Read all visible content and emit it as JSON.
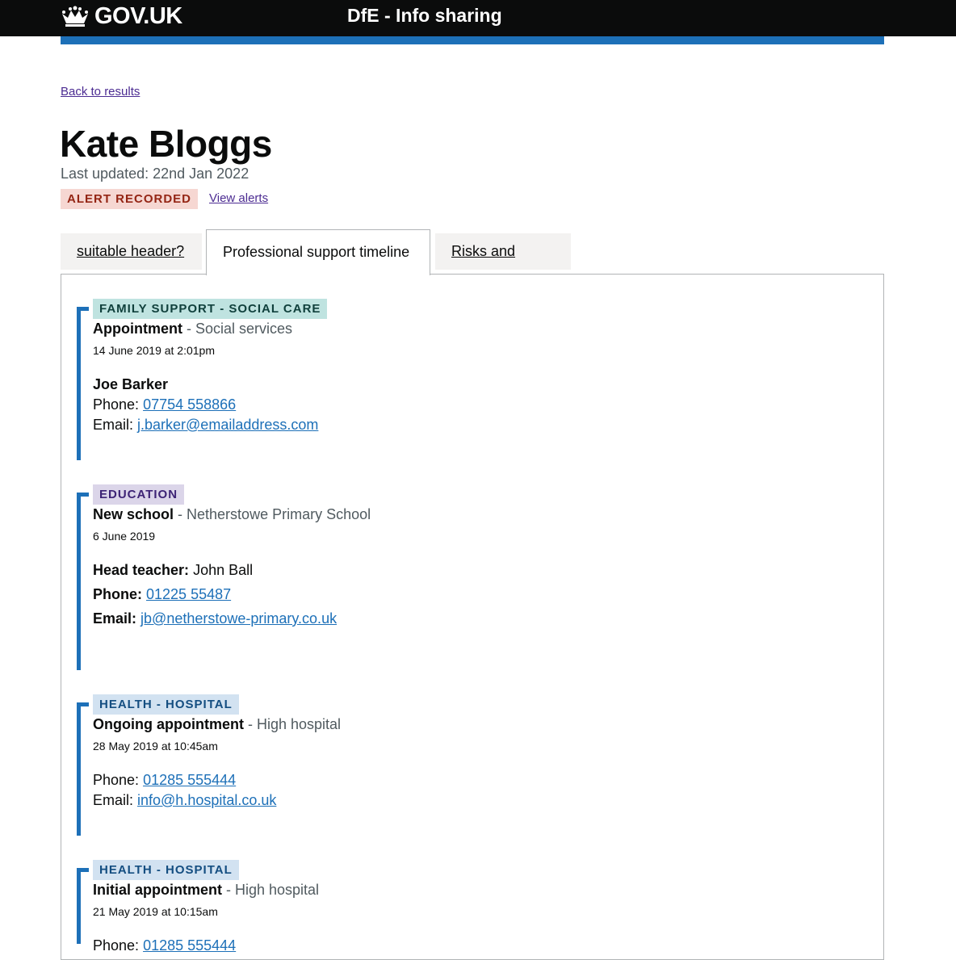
{
  "header": {
    "logo_text": "GOV.UK",
    "service_name": "DfE - Info sharing"
  },
  "page": {
    "back_link": "Back to results",
    "title": "Kate Bloggs",
    "last_updated": "Last updated: 22nd Jan 2022",
    "alert_tag": "ALERT RECORDED",
    "view_alerts": "View alerts"
  },
  "tabs": [
    {
      "label": "suitable header?",
      "active": false
    },
    {
      "label": "Professional support timeline",
      "active": true
    },
    {
      "label": "Risks and alerts",
      "active": false
    }
  ],
  "timeline": [
    {
      "tag": "FAMILY SUPPORT - SOCIAL CARE",
      "tag_color": "#bfe3e0",
      "title": "Appointment",
      "organisation": " - Social services",
      "datetime": "14 June 2019 at 2:01pm",
      "contact_name": "Joe Barker",
      "phone_label": "Phone: ",
      "phone": "07754 558866",
      "email_label": "Email: ",
      "email": "j.barker@emailaddress.com"
    },
    {
      "tag": "EDUCATION",
      "tag_color": "#dbd5e9",
      "title": "New school",
      "organisation": " - Netherstowe Primary School",
      "datetime": "6 June 2019",
      "head_label": "Head teacher:",
      "head_value": " John Ball",
      "phone_label": "Phone:",
      "phone": "01225 55487",
      "email_label": "Email:",
      "email": "jb@netherstowe-primary.co.uk"
    },
    {
      "tag": "HEALTH - HOSPITAL",
      "tag_color": "#d2e2f1",
      "title": "Ongoing appointment",
      "organisation": " - High hospital",
      "datetime": "28 May 2019 at 10:45am",
      "phone_label": "Phone: ",
      "phone": "01285 555444",
      "email_label": "Email: ",
      "email": "info@h.hospital.co.uk"
    },
    {
      "tag": "HEALTH - HOSPITAL",
      "tag_color": "#d2e2f1",
      "title": "Initial appointment",
      "organisation": " - High hospital",
      "datetime": "21 May 2019 at 10:15am",
      "phone_label": "Phone: ",
      "phone": "01285 555444"
    }
  ],
  "icons": {
    "logo_icon": "crown-icon"
  },
  "colors": {
    "header_bg": "#0b0c0c",
    "brand_blue": "#1d70b8",
    "link_visited": "#4c2c92",
    "alert_bg": "#f6d7d2",
    "alert_text": "#942514"
  }
}
